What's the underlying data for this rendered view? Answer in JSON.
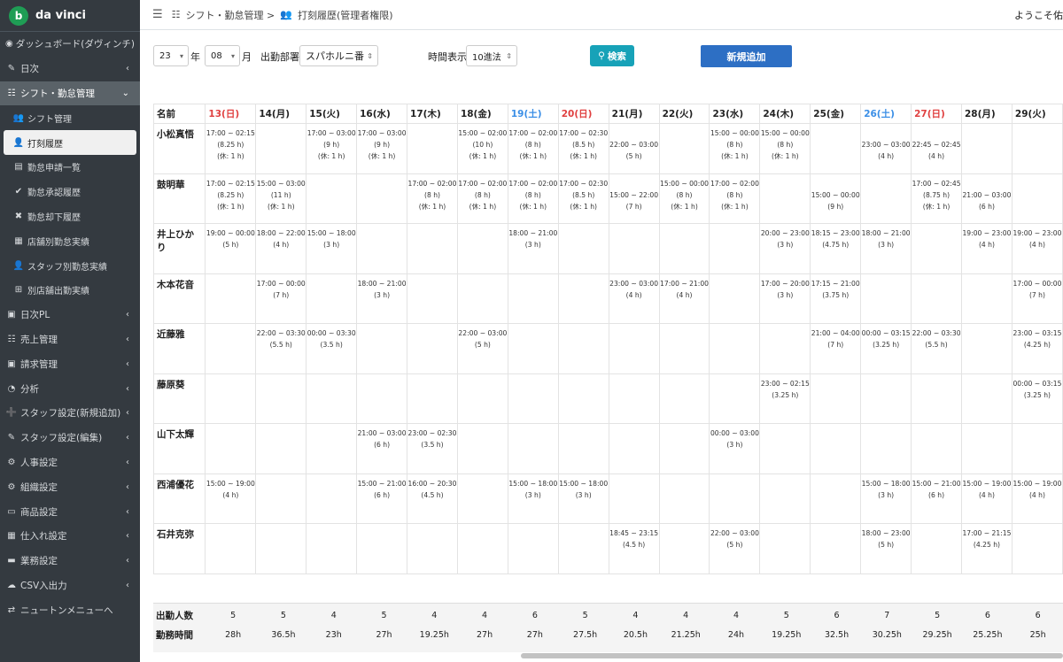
{
  "brand": {
    "name": "da vinci",
    "logo_icon": "leaf-logo-icon"
  },
  "sidebar": {
    "items": [
      {
        "label": "ダッシュボード(ダヴィンチ)",
        "icon": "dashboard-icon",
        "chevron": false
      },
      {
        "label": "日次",
        "icon": "edit-icon",
        "chevron": true
      },
      {
        "label": "シフト・勤怠管理",
        "icon": "list-icon",
        "chevron": true,
        "open": true
      },
      {
        "label": "シフト管理",
        "icon": "users-icon",
        "sub": true
      },
      {
        "label": "打刻履歴",
        "icon": "user-clock-icon",
        "sub": true,
        "active": true
      },
      {
        "label": "勤怠申請一覧",
        "icon": "file-icon",
        "sub": true
      },
      {
        "label": "勤怠承認履歴",
        "icon": "check-icon",
        "sub": true
      },
      {
        "label": "勤怠却下履歴",
        "icon": "reject-icon",
        "sub": true
      },
      {
        "label": "店舗別勤怠実績",
        "icon": "store-icon",
        "sub": true
      },
      {
        "label": "スタッフ別勤怠実績",
        "icon": "user-icon",
        "sub": true
      },
      {
        "label": "別店舗出勤実績",
        "icon": "sitemap-icon",
        "sub": true
      },
      {
        "label": "日次PL",
        "icon": "calendar-icon",
        "chevron": true
      },
      {
        "label": "売上管理",
        "icon": "list-icon",
        "chevron": true
      },
      {
        "label": "請求管理",
        "icon": "calendar-icon",
        "chevron": true
      },
      {
        "label": "分析",
        "icon": "pie-chart-icon",
        "chevron": true
      },
      {
        "label": "スタッフ設定(新規追加)",
        "icon": "user-plus-icon",
        "chevron": true
      },
      {
        "label": "スタッフ設定(編集)",
        "icon": "user-edit-icon",
        "chevron": true
      },
      {
        "label": "人事設定",
        "icon": "gear-icon",
        "chevron": true
      },
      {
        "label": "組織設定",
        "icon": "users-gear-icon",
        "chevron": true
      },
      {
        "label": "商品設定",
        "icon": "box-icon",
        "chevron": true
      },
      {
        "label": "仕入れ設定",
        "icon": "store-icon",
        "chevron": true
      },
      {
        "label": "業務設定",
        "icon": "card-icon",
        "chevron": true
      },
      {
        "label": "CSV入出力",
        "icon": "cloud-icon",
        "chevron": true
      },
      {
        "label": "ニュートンメニューへ",
        "icon": "exchange-icon",
        "chevron": false
      }
    ]
  },
  "topbar": {
    "crumb1": "シフト・勤怠管理 >",
    "crumb2": "打刻履歴(管理者権限)",
    "welcome": "ようこそ佑"
  },
  "filters": {
    "year_value": "23",
    "year_suffix": "年",
    "month_value": "08",
    "month_suffix": "月",
    "dept_label": "出勤部署",
    "dept_value": "スパホルニ番",
    "time_label": "時間表示",
    "time_value": "10進法",
    "search_label": "検索",
    "add_label": "新規追加"
  },
  "table": {
    "name_header": "名前",
    "days": [
      {
        "label": "13(日)",
        "type": "sun"
      },
      {
        "label": "14(月)",
        "type": "weekday"
      },
      {
        "label": "15(火)",
        "type": "weekday"
      },
      {
        "label": "16(水)",
        "type": "weekday"
      },
      {
        "label": "17(木)",
        "type": "weekday"
      },
      {
        "label": "18(金)",
        "type": "weekday"
      },
      {
        "label": "19(土)",
        "type": "sat"
      },
      {
        "label": "20(日)",
        "type": "sun"
      },
      {
        "label": "21(月)",
        "type": "weekday"
      },
      {
        "label": "22(火)",
        "type": "weekday"
      },
      {
        "label": "23(水)",
        "type": "weekday"
      },
      {
        "label": "24(木)",
        "type": "weekday"
      },
      {
        "label": "25(金)",
        "type": "weekday"
      },
      {
        "label": "26(土)",
        "type": "sat"
      },
      {
        "label": "27(日)",
        "type": "sun"
      },
      {
        "label": "28(月)",
        "type": "weekday"
      },
      {
        "label": "29(火)",
        "type": "weekday"
      }
    ],
    "rows": [
      {
        "name": "小松真悟",
        "cells": [
          [
            "17:00 ~ 02:15",
            "(8.25 h)",
            "(休: 1 h)"
          ],
          [],
          [
            "17:00 ~ 03:00",
            "(9 h)",
            "(休: 1 h)"
          ],
          [
            "17:00 ~ 03:00",
            "(9 h)",
            "(休: 1 h)"
          ],
          [],
          [
            "15:00 ~ 02:00",
            "(10 h)",
            "(休: 1 h)"
          ],
          [
            "17:00 ~ 02:00",
            "(8 h)",
            "(休: 1 h)"
          ],
          [
            "17:00 ~ 02:30",
            "(8.5 h)",
            "(休: 1 h)"
          ],
          [
            "",
            "22:00 ~ 03:00",
            "(5 h)"
          ],
          [],
          [
            "15:00 ~ 00:00",
            "(8 h)",
            "(休: 1 h)"
          ],
          [
            "15:00 ~ 00:00",
            "(8 h)",
            "(休: 1 h)"
          ],
          [],
          [
            "",
            "23:00 ~ 03:00",
            "(4 h)"
          ],
          [
            "",
            "22:45 ~ 02:45",
            "(4 h)"
          ],
          [],
          []
        ]
      },
      {
        "name": "鼓明華",
        "cells": [
          [
            "17:00 ~ 02:15",
            "(8.25 h)",
            "(休: 1 h)"
          ],
          [
            "15:00 ~ 03:00",
            "(11 h)",
            "(休: 1 h)"
          ],
          [],
          [],
          [
            "17:00 ~ 02:00",
            "(8 h)",
            "(休: 1 h)"
          ],
          [
            "17:00 ~ 02:00",
            "(8 h)",
            "(休: 1 h)"
          ],
          [
            "17:00 ~ 02:00",
            "(8 h)",
            "(休: 1 h)"
          ],
          [
            "17:00 ~ 02:30",
            "(8.5 h)",
            "(休: 1 h)"
          ],
          [
            "",
            "15:00 ~ 22:00",
            "(7 h)"
          ],
          [
            "15:00 ~ 00:00",
            "(8 h)",
            "(休: 1 h)"
          ],
          [
            "17:00 ~ 02:00",
            "(8 h)",
            "(休: 1 h)"
          ],
          [],
          [
            "",
            "15:00 ~ 00:00",
            "(9 h)"
          ],
          [],
          [
            "17:00 ~ 02:45",
            "(8.75 h)",
            "(休: 1 h)"
          ],
          [
            "",
            "21:00 ~ 03:00",
            "(6 h)"
          ],
          []
        ]
      },
      {
        "name": "井上ひかり",
        "cells": [
          [
            "19:00 ~ 00:00",
            "(5 h)"
          ],
          [
            "18:00 ~ 22:00",
            "(4 h)"
          ],
          [
            "15:00 ~ 18:00",
            "(3 h)"
          ],
          [],
          [],
          [],
          [
            "18:00 ~ 21:00",
            "(3 h)"
          ],
          [],
          [],
          [],
          [],
          [
            "20:00 ~ 23:00",
            "(3 h)"
          ],
          [
            "18:15 ~ 23:00",
            "(4.75 h)"
          ],
          [
            "18:00 ~ 21:00",
            "(3 h)"
          ],
          [],
          [
            "19:00 ~ 23:00",
            "(4 h)"
          ],
          [
            "19:00 ~ 23:00",
            "(4 h)"
          ]
        ]
      },
      {
        "name": "木本花音",
        "cells": [
          [],
          [
            "17:00 ~ 00:00",
            "(7 h)"
          ],
          [],
          [
            "18:00 ~ 21:00",
            "(3 h)"
          ],
          [],
          [],
          [],
          [],
          [
            "23:00 ~ 03:00",
            "(4 h)"
          ],
          [
            "17:00 ~ 21:00",
            "(4 h)"
          ],
          [],
          [
            "17:00 ~ 20:00",
            "(3 h)"
          ],
          [
            "17:15 ~ 21:00",
            "(3.75 h)"
          ],
          [],
          [],
          [],
          [
            "17:00 ~ 00:00",
            "(7 h)"
          ]
        ]
      },
      {
        "name": "近藤雅",
        "cells": [
          [],
          [
            "22:00 ~ 03:30",
            "(5.5 h)"
          ],
          [
            "00:00 ~ 03:30",
            "(3.5 h)"
          ],
          [],
          [],
          [
            "22:00 ~ 03:00",
            "(5 h)"
          ],
          [],
          [],
          [],
          [],
          [],
          [],
          [
            "21:00 ~ 04:00",
            "(7 h)"
          ],
          [
            "00:00 ~ 03:15",
            "(3.25 h)"
          ],
          [
            "22:00 ~ 03:30",
            "(5.5 h)"
          ],
          [],
          [
            "23:00 ~ 03:15",
            "(4.25 h)"
          ]
        ]
      },
      {
        "name": "藤原葵",
        "cells": [
          [],
          [],
          [],
          [],
          [],
          [],
          [],
          [],
          [],
          [],
          [],
          [
            "23:00 ~ 02:15",
            "(3.25 h)"
          ],
          [],
          [],
          [],
          [],
          [
            "00:00 ~ 03:15",
            "(3.25 h)"
          ]
        ]
      },
      {
        "name": "山下太輝",
        "cells": [
          [],
          [],
          [],
          [
            "21:00 ~ 03:00",
            "(6 h)"
          ],
          [
            "23:00 ~ 02:30",
            "(3.5 h)"
          ],
          [],
          [],
          [],
          [],
          [],
          [
            "00:00 ~ 03:00",
            "(3 h)"
          ],
          [],
          [],
          [],
          [],
          [],
          []
        ]
      },
      {
        "name": "西浦優花",
        "cells": [
          [
            "15:00 ~ 19:00",
            "(4 h)"
          ],
          [],
          [],
          [
            "15:00 ~ 21:00",
            "(6 h)"
          ],
          [
            "16:00 ~ 20:30",
            "(4.5 h)"
          ],
          [],
          [
            "15:00 ~ 18:00",
            "(3 h)"
          ],
          [
            "15:00 ~ 18:00",
            "(3 h)"
          ],
          [],
          [],
          [],
          [],
          [],
          [
            "15:00 ~ 18:00",
            "(3 h)"
          ],
          [
            "15:00 ~ 21:00",
            "(6 h)"
          ],
          [
            "15:00 ~ 19:00",
            "(4 h)"
          ],
          [
            "15:00 ~ 19:00",
            "(4 h)"
          ]
        ]
      },
      {
        "name": "石井克弥",
        "cells": [
          [],
          [],
          [],
          [],
          [],
          [],
          [],
          [],
          [
            "18:45 ~ 23:15",
            "(4.5 h)"
          ],
          [],
          [
            "22:00 ~ 03:00",
            "(5 h)"
          ],
          [],
          [],
          [
            "18:00 ~ 23:00",
            "(5 h)"
          ],
          [],
          [
            "17:00 ~ 21:15",
            "(4.25 h)"
          ],
          []
        ]
      }
    ]
  },
  "summary": {
    "count_label": "出勤人数",
    "hours_label": "勤務時間",
    "counts": [
      "5",
      "5",
      "4",
      "5",
      "4",
      "4",
      "6",
      "5",
      "4",
      "4",
      "4",
      "5",
      "6",
      "7",
      "5",
      "6",
      "6"
    ],
    "hours": [
      "28h",
      "36.5h",
      "23h",
      "27h",
      "19.25h",
      "27h",
      "27h",
      "27.5h",
      "20.5h",
      "21.25h",
      "24h",
      "19.25h",
      "32.5h",
      "30.25h",
      "29.25h",
      "25.25h",
      "25h"
    ]
  }
}
